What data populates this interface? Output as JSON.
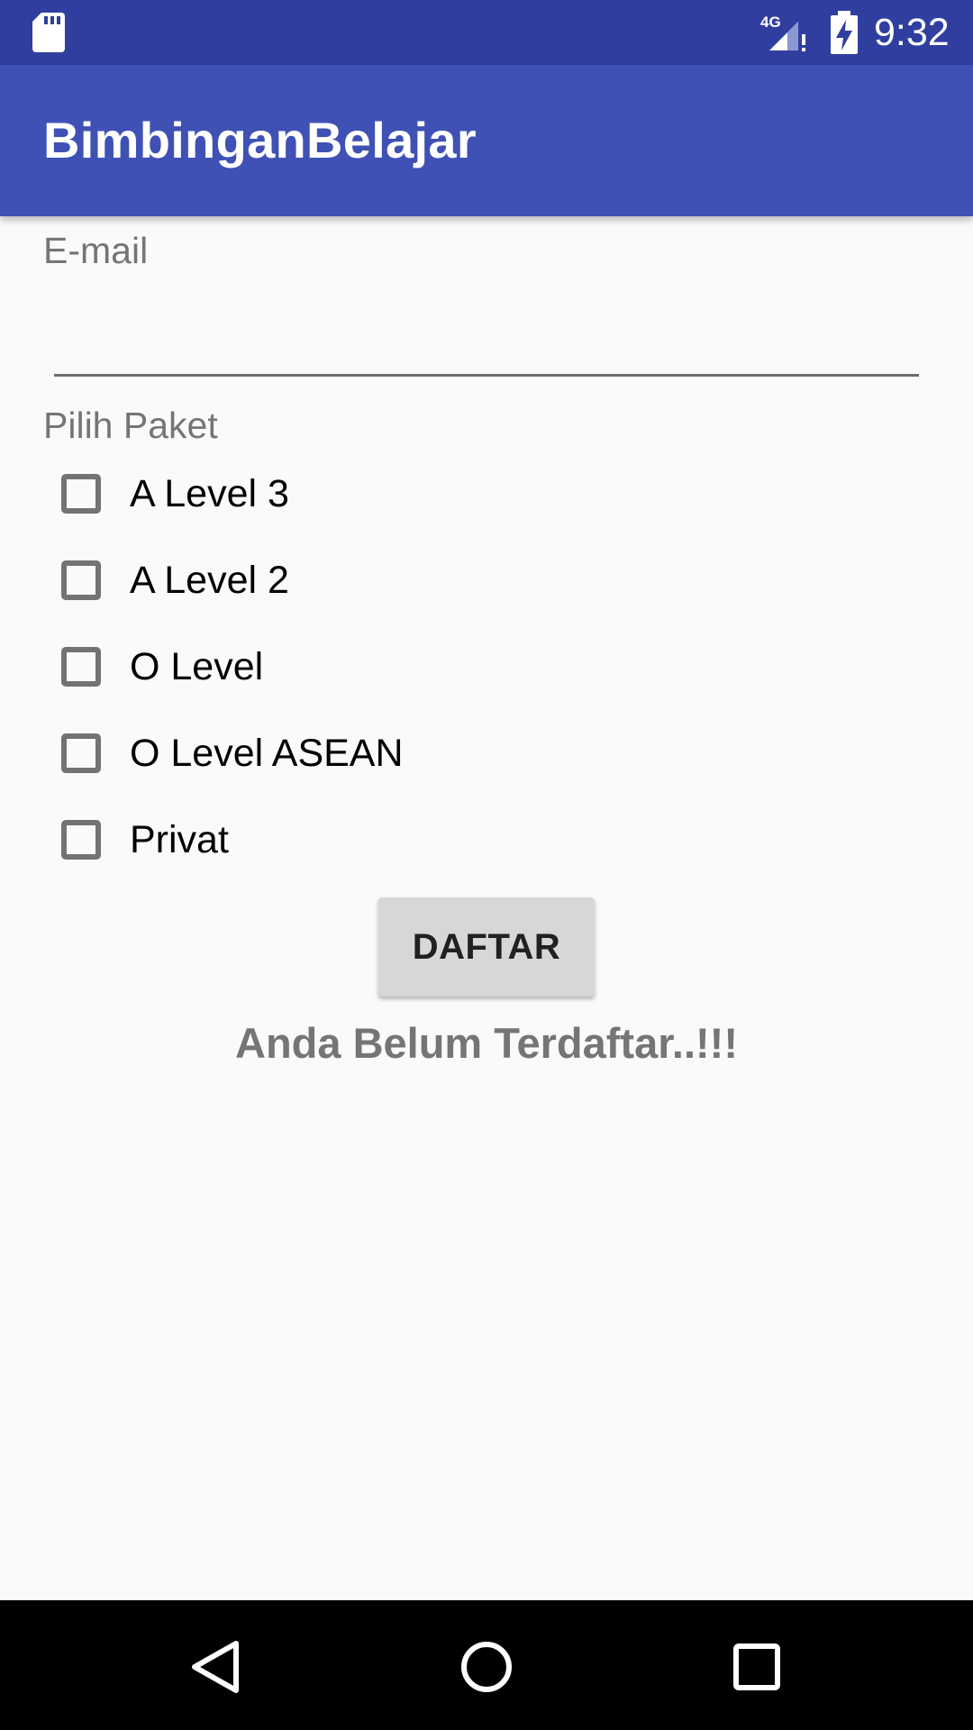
{
  "status_bar": {
    "time": "9:32",
    "network_label": "4G",
    "background": "#303f9f",
    "icons": [
      "sd-card-icon",
      "signal-4g-icon",
      "battery-charging-icon"
    ]
  },
  "app_bar": {
    "title": "BimbinganBelajar",
    "background": "#3f51b5"
  },
  "form": {
    "email_label": "E-mail",
    "email_value": "",
    "paket_label": "Pilih Paket",
    "packages": [
      {
        "label": "A Level 3",
        "checked": false
      },
      {
        "label": "A Level 2",
        "checked": false
      },
      {
        "label": "O Level",
        "checked": false
      },
      {
        "label": "O Level ASEAN",
        "checked": false
      },
      {
        "label": "Privat",
        "checked": false
      }
    ],
    "submit_label": "DAFTAR",
    "status_message": "Anda Belum Terdaftar..!!!"
  },
  "nav_bar": {
    "icons": [
      "back-icon",
      "home-icon",
      "recents-icon"
    ]
  }
}
